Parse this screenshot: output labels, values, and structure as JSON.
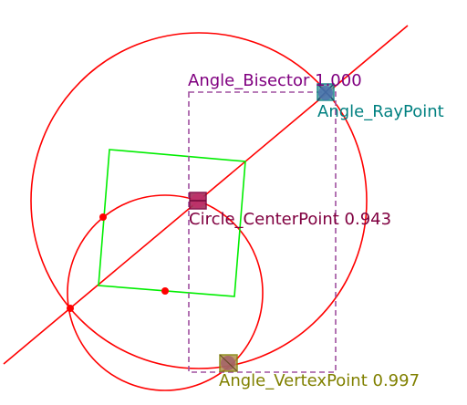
{
  "colors": {
    "background": "#ffffff",
    "construction_red": "#ff0000",
    "square_green": "#00ee00",
    "bisector_purple": "#800080",
    "bbox_dash": "#a050a0",
    "ray_teal": "#008080",
    "center_maroon": "#800040",
    "vertex_olive": "#808000"
  },
  "detections": [
    {
      "label": "Angle_Bisector",
      "score": "1.000",
      "text": "Angle_Bisector 1.000",
      "color": "#800080"
    },
    {
      "label": "Angle_RayPoint",
      "score": "",
      "text": "Angle_RayPoint",
      "color": "#008080"
    },
    {
      "label": "Circle_CenterPoint",
      "score": "0.943",
      "text": "Circle_CenterPoint 0.943",
      "color": "#800040"
    },
    {
      "label": "Angle_VertexPoint",
      "score": "0.997",
      "text": "Angle_VertexPoint 0.997",
      "color": "#808000"
    }
  ],
  "shapes": {
    "large_circle": "circle",
    "small_circle": "circle",
    "bisector_line": "line",
    "green_square": "square",
    "points": [
      "intersection-point",
      "midpoint",
      "small-point"
    ]
  }
}
